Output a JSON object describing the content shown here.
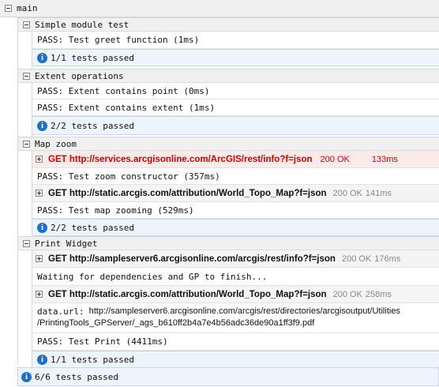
{
  "root": {
    "label": "main"
  },
  "suites": [
    {
      "title": "Simple module test",
      "rows": [
        {
          "kind": "text",
          "text": "PASS: Test greet function (1ms)"
        },
        {
          "kind": "summary",
          "text": "1/1 tests passed"
        }
      ]
    },
    {
      "title": "Extent operations",
      "rows": [
        {
          "kind": "text",
          "text": "PASS: Extent contains point (0ms)"
        },
        {
          "kind": "text",
          "text": "PASS: Extent contains extent (1ms)"
        },
        {
          "kind": "summary",
          "text": "2/2 tests passed"
        }
      ]
    },
    {
      "title": "Map zoom",
      "rows": [
        {
          "kind": "xhr",
          "request": "GET http://services.arcgisonline.com/ArcGIS/rest/info?f=json",
          "status": "200 OK",
          "time": "133ms",
          "error": true
        },
        {
          "kind": "text",
          "text": "PASS: Test zoom constructor (357ms)"
        },
        {
          "kind": "xhr",
          "request": "GET http://static.arcgis.com/attribution/World_Topo_Map?f=json",
          "status": "200 OK",
          "time": "141ms",
          "error": false
        },
        {
          "kind": "text",
          "text": "PASS: Test map zooming (529ms)"
        },
        {
          "kind": "summary",
          "text": "2/2 tests passed"
        }
      ]
    },
    {
      "title": "Print Widget",
      "rows": [
        {
          "kind": "xhr",
          "request": "GET http://sampleserver6.arcgisonline.com/arcgis/rest/info?f=json",
          "status": "200 OK",
          "time": "176ms",
          "error": false
        },
        {
          "kind": "text",
          "text": "Waiting for dependencies and GP to finish..."
        },
        {
          "kind": "xhr",
          "request": "GET http://static.arcgis.com/attribution/World_Topo_Map?f=json",
          "status": "200 OK",
          "time": "258ms",
          "error": false
        },
        {
          "kind": "data",
          "label": "data.url:",
          "line1": "http://sampleserver6.arcgisonline.com/arcgis/rest/directories/arcgisoutput/Utilities",
          "line2": "/PrintingTools_GPServer/_ags_b610ff2b4a7e4b56adc36de90a1ff3f9.pdf"
        },
        {
          "kind": "text",
          "text": "PASS: Test Print (4411ms)"
        },
        {
          "kind": "summary",
          "text": "1/1 tests passed"
        }
      ]
    }
  ],
  "total": {
    "text": "6/6 tests passed"
  },
  "icons": {
    "collapse": "minus-box-icon",
    "expand": "plus-box-icon",
    "info": "info-icon"
  },
  "colors": {
    "error": "#d00000",
    "info": "#1f6fc5",
    "summary_bg": "#eef4fc",
    "header_bg": "#f0f0f0"
  }
}
